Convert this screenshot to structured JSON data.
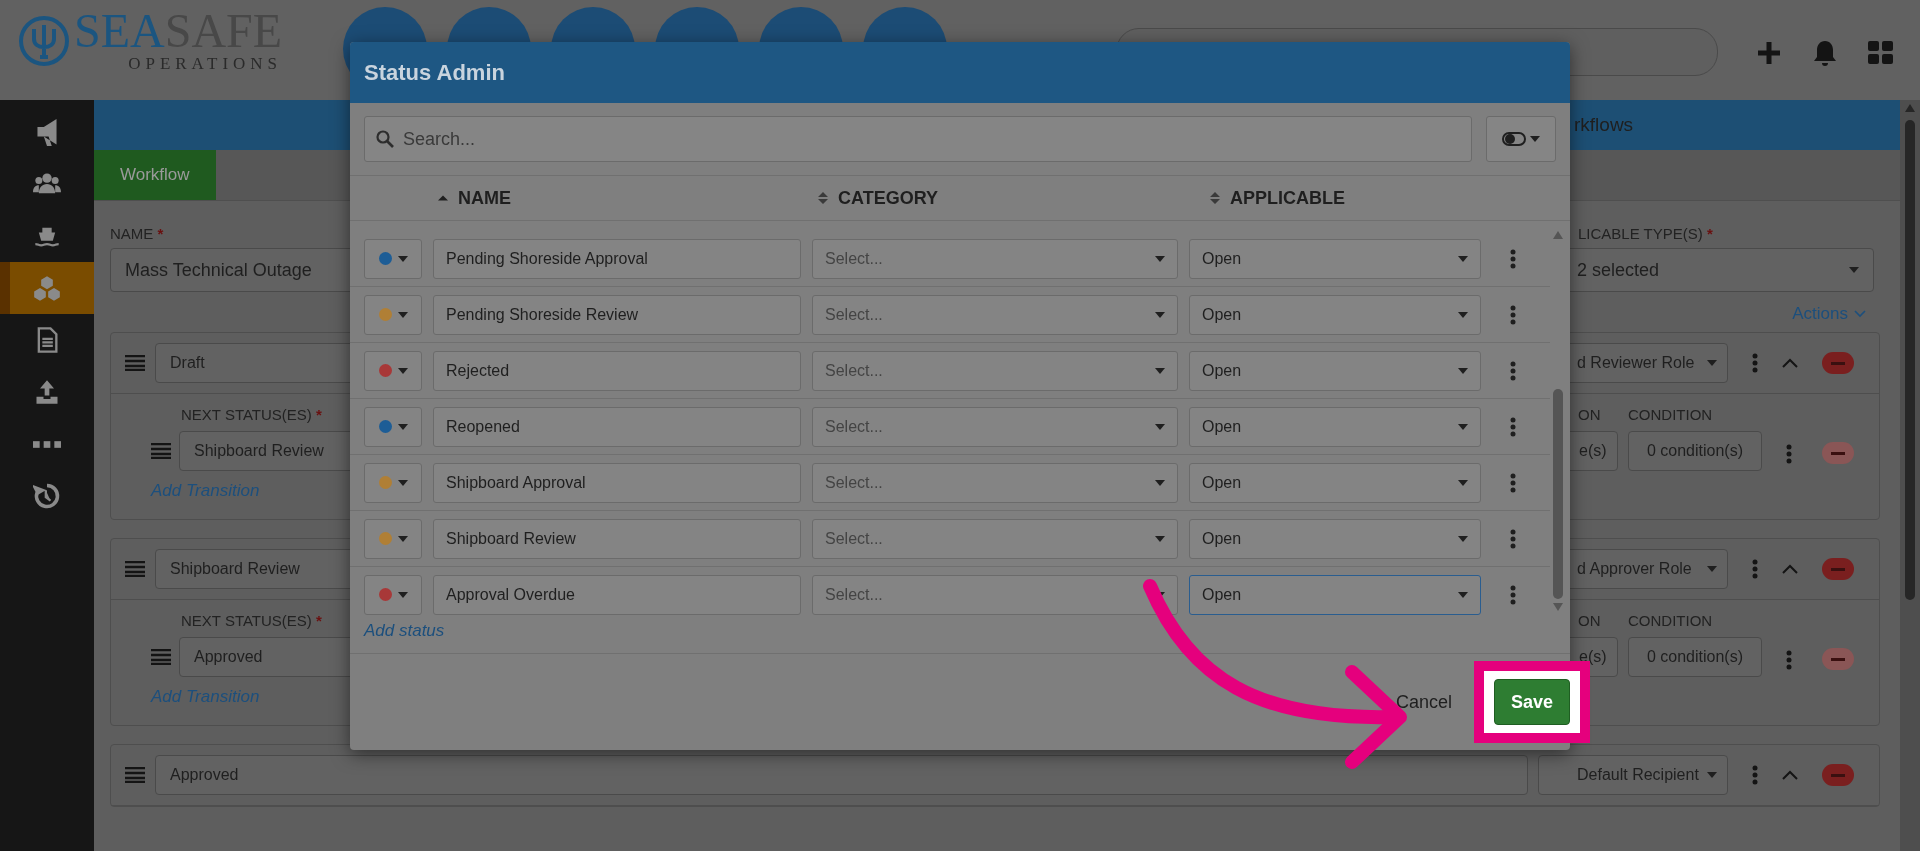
{
  "header": {
    "logo": {
      "primary": "SEA",
      "secondary": "SAFE",
      "tagline": "OPERATIONS"
    }
  },
  "sidebar": {
    "items": [
      {
        "kind": "megaphone",
        "selected": false
      },
      {
        "kind": "users",
        "selected": false
      },
      {
        "kind": "ship",
        "selected": false
      },
      {
        "kind": "cubes",
        "selected": true
      },
      {
        "kind": "document",
        "selected": false
      },
      {
        "kind": "upload",
        "selected": false
      },
      {
        "kind": "dots",
        "selected": false
      },
      {
        "kind": "history",
        "selected": false
      }
    ]
  },
  "page": {
    "title": "rkflows",
    "tabs": [
      {
        "label": "Workflow",
        "selected": true
      }
    ],
    "name_label": "NAME",
    "name_required": "*",
    "types_required": "*",
    "name_value": "Mass Technical Outage",
    "types_label": "LICABLE TYPE(S)",
    "types_value": "2 selected",
    "actions_link": "Actions",
    "statuses": [
      {
        "name": "Draft",
        "role": "d Reviewer Role",
        "expanded": true,
        "transition": {
          "label": "NEXT STATUS(ES)",
          "required_mark": "*",
          "value": "Shipboard Review",
          "col_label": "ON",
          "col_value": "e(s)",
          "condition_label": "CONDITION",
          "condition_value": "0 condition(s)",
          "link": "Add Transition"
        }
      },
      {
        "name": "Shipboard Review",
        "role": "d Approver Role",
        "expanded": true,
        "transition": {
          "label": "NEXT STATUS(ES)",
          "required_mark": "*",
          "value": "Approved",
          "col_label": "ON",
          "col_value": "e(s)",
          "condition_label": "CONDITION",
          "condition_value": "0 condition(s)",
          "link": "Add Transition"
        }
      },
      {
        "name": "Approved",
        "role": "Default Recipient",
        "expanded": true
      }
    ]
  },
  "modal": {
    "title": "Status Admin",
    "search": {
      "placeholder": "Search..."
    },
    "columns": [
      {
        "label": "NAME",
        "sorted": true
      },
      {
        "label": "CATEGORY",
        "sorted": false
      },
      {
        "label": "APPLICABLE",
        "sorted": false
      }
    ],
    "rows": [
      {
        "color": "#1d5d96",
        "name": "Pending Shoreside Approval",
        "category_placeholder": "Select...",
        "applicable": "Open",
        "focused": false
      },
      {
        "color": "#b07f35",
        "name": "Pending Shoreside Review",
        "category_placeholder": "Select...",
        "applicable": "Open",
        "focused": false
      },
      {
        "color": "#a83838",
        "name": "Rejected",
        "category_placeholder": "Select...",
        "applicable": "Open",
        "focused": false
      },
      {
        "color": "#1d5d96",
        "name": "Reopened",
        "category_placeholder": "Select...",
        "applicable": "Open",
        "focused": false
      },
      {
        "color": "#b07f35",
        "name": "Shipboard Approval",
        "category_placeholder": "Select...",
        "applicable": "Open",
        "focused": false
      },
      {
        "color": "#b07f35",
        "name": "Shipboard Review",
        "category_placeholder": "Select...",
        "applicable": "Open",
        "focused": false
      },
      {
        "color": "#a83838",
        "name": "Approval Overdue",
        "category_placeholder": "Select...",
        "applicable": "Open",
        "focused": true
      }
    ],
    "add_link": "Add status",
    "cancel": "Cancel",
    "save": "Save",
    "save_highlighted": true
  }
}
